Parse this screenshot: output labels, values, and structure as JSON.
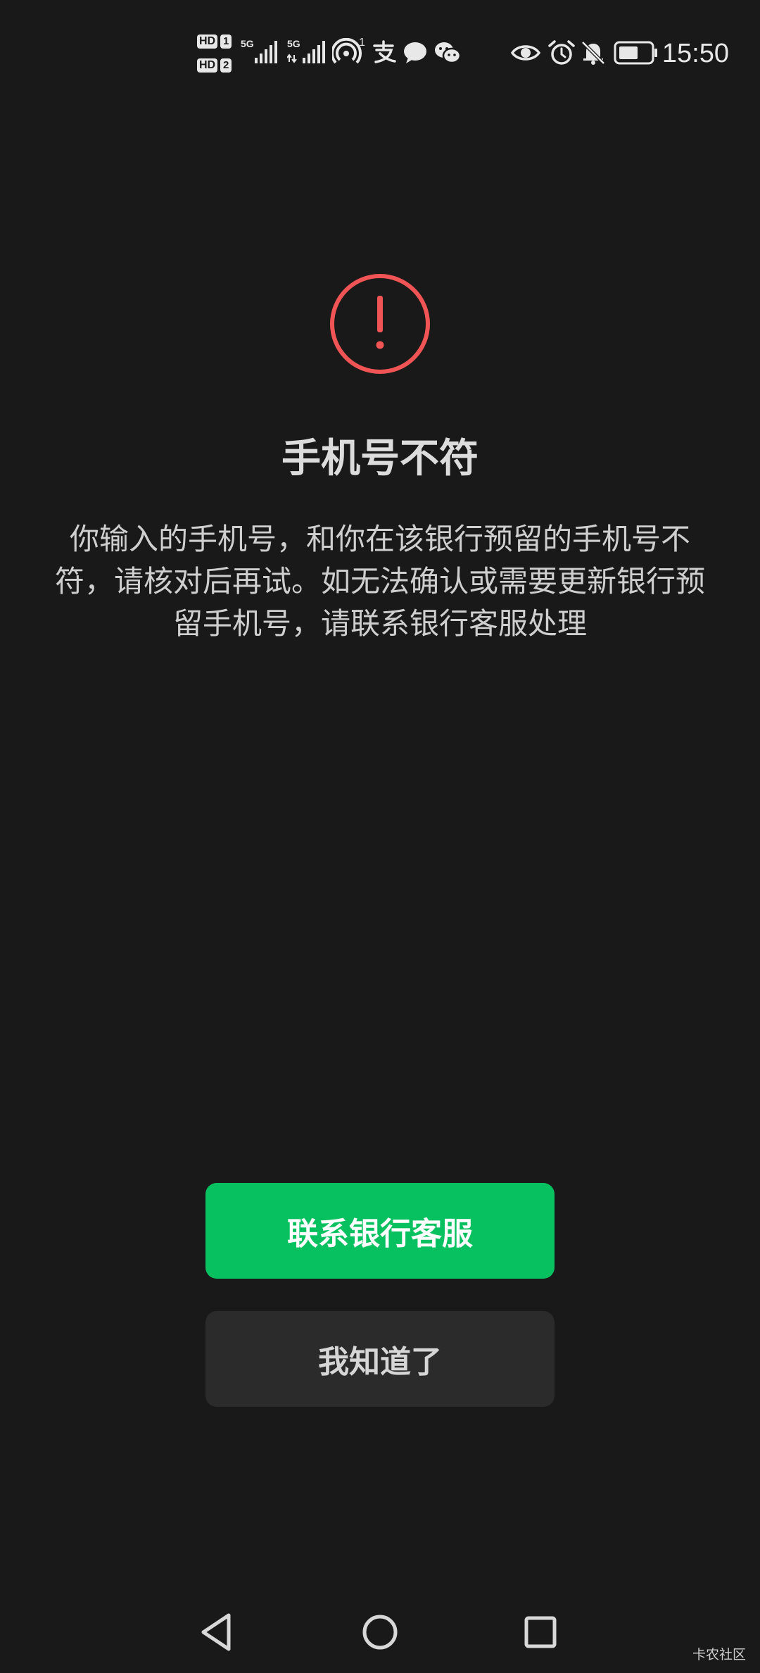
{
  "status_bar": {
    "sim1_label": "HD",
    "sim1_slot": "1",
    "sim2_label": "HD",
    "sim2_slot": "2",
    "signal1_tag": "5G",
    "signal2_tag": "5G",
    "hotspot_count": "1",
    "time": "15:50",
    "icons": [
      "sim-hd-icon",
      "signal-5g-icon",
      "hotspot-icon",
      "alipay-icon",
      "message-icon",
      "wechat-icon",
      "eye-comfort-icon",
      "alarm-icon",
      "mute-icon",
      "battery-icon"
    ]
  },
  "dialog": {
    "icon": "exclamation-circle-icon",
    "icon_color": "#f05454",
    "title": "手机号不符",
    "message": "你输入的手机号，和你在该银行预留的手机号不符，请核对后再试。如无法确认或需要更新银行预留手机号，请联系银行客服处理"
  },
  "buttons": {
    "contact_bank": "联系银行客服",
    "acknowledge": "我知道了",
    "primary_color": "#07c160"
  },
  "nav_bar": {
    "icons": [
      "back-triangle-icon",
      "home-circle-icon",
      "recents-square-icon"
    ]
  },
  "watermark": "卡农社区"
}
